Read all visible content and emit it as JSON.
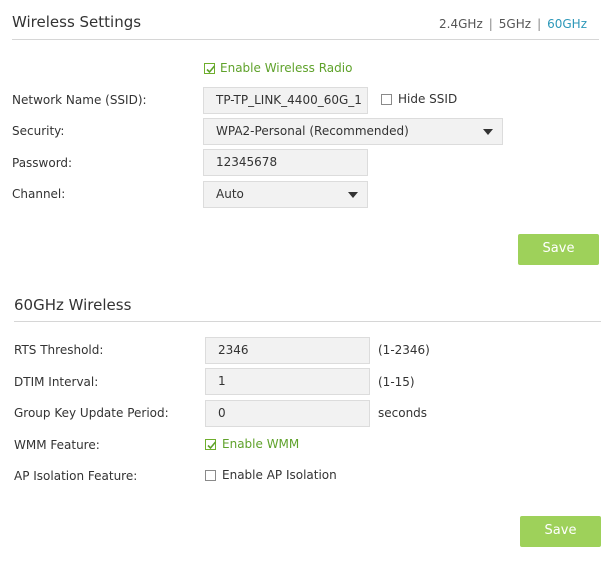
{
  "wireless": {
    "title": "Wireless Settings",
    "bands": [
      {
        "label": "2.4GHz",
        "active": false
      },
      {
        "label": "5GHz",
        "active": false
      },
      {
        "label": "60GHz",
        "active": true
      }
    ],
    "band_sep": "|",
    "enable_radio": {
      "label": "Enable Wireless Radio",
      "checked": true
    },
    "ssid": {
      "label": "Network Name (SSID):",
      "value": "TP-TP_LINK_4400_60G_1"
    },
    "hide_ssid": {
      "label": "Hide SSID",
      "checked": false
    },
    "security": {
      "label": "Security:",
      "value": "WPA2-Personal (Recommended)"
    },
    "password": {
      "label": "Password:",
      "value": "12345678"
    },
    "channel": {
      "label": "Channel:",
      "value": "Auto"
    },
    "save_label": "Save"
  },
  "advanced": {
    "title": "60GHz Wireless",
    "rts": {
      "label": "RTS Threshold:",
      "value": "2346",
      "hint": "(1-2346)"
    },
    "dtim": {
      "label": "DTIM Interval:",
      "value": "1",
      "hint": "(1-15)"
    },
    "group_key": {
      "label": "Group Key Update Period:",
      "value": "0",
      "hint": "seconds"
    },
    "wmm": {
      "label": "WMM Feature:",
      "option": "Enable WMM",
      "checked": true
    },
    "ap_isolation": {
      "label": "AP Isolation Feature:",
      "option": "Enable AP Isolation",
      "checked": false
    },
    "save_label": "Save"
  },
  "colors": {
    "accent_green": "#5fa22b",
    "button_green": "#9ed15a",
    "active_tab_blue": "#2d98b9"
  }
}
